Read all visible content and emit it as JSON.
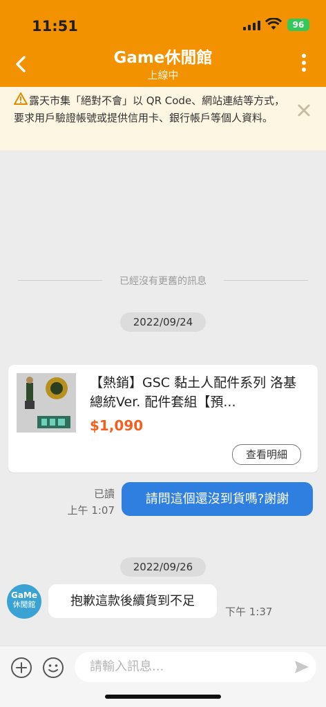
{
  "status_bar": {
    "time": "11:51",
    "battery": "96"
  },
  "header": {
    "title": "Game休閒館",
    "subtitle": "上線中"
  },
  "notice": {
    "text": "露天市集「絕對不會」以 QR Code、網站連結等方式，要求用戶驗證帳號或提供信用卡、銀行帳戶等個人資料。"
  },
  "chat": {
    "no_more_text": "已經沒有更舊的訊息",
    "date1": "2022/09/24",
    "product": {
      "title": "【熱銷】GSC 黏土人配件系列 洛基 總統Ver. 配件套組【預...",
      "price": "$1,090",
      "details_label": "查看明細"
    },
    "sent": {
      "read_label": "已讀",
      "time": "上午 1:07",
      "text": "請問這個還沒到貨嗎?謝謝"
    },
    "date2": "2022/09/26",
    "received": {
      "avatar_line1": "GaMe",
      "avatar_line2": "休閒館",
      "text": "抱歉這款後續貨到不足",
      "time": "下午 1:37"
    }
  },
  "composer": {
    "placeholder": "請輸入訊息..."
  },
  "colors": {
    "header": "#f39200",
    "price": "#f2601f",
    "bubble_out": "#2e7fe0",
    "battery": "#35c759"
  }
}
